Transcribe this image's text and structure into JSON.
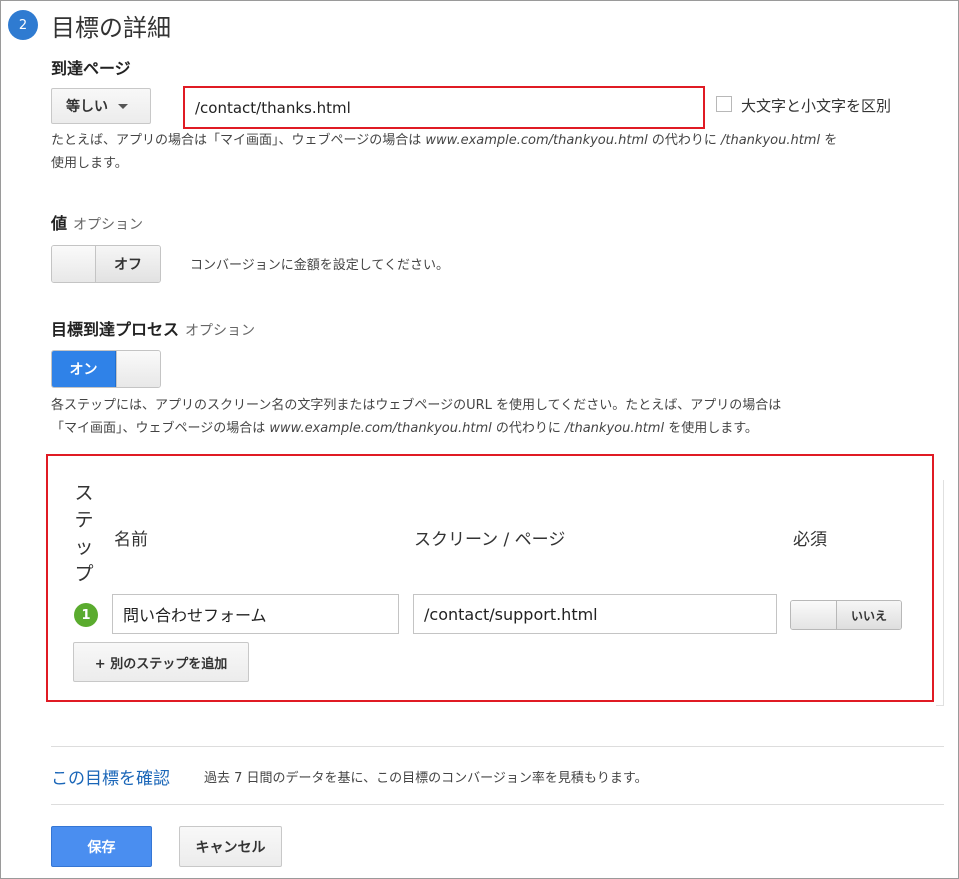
{
  "section": {
    "step_number": "2",
    "title": "目標の詳細"
  },
  "destination": {
    "label": "到達ページ",
    "match_type": "等しい",
    "url_value": "/contact/thanks.html",
    "case_sensitive_label": "大文字と小文字を区別",
    "help_part1": "たとえば、アプリの場合は「マイ画面」、ウェブページの場合は ",
    "help_example1": "www.example.com/thankyou.html",
    "help_part2": " の代わりに ",
    "help_example2": "/thankyou.html",
    "help_part3": " を",
    "help_line2": "使用します。"
  },
  "value": {
    "label": "値",
    "optional": "オプション",
    "toggle_state": "オフ",
    "description": "コンバージョンに金額を設定してください。"
  },
  "funnel": {
    "label": "目標到達プロセス",
    "optional": "オプション",
    "toggle_state": "オン",
    "help_line1": "各ステップには、アプリのスクリーン名の文字列またはウェブページのURL を使用してください。たとえば、アプリの場合は",
    "help_part1": "「マイ画面」、ウェブページの場合は ",
    "help_example1": "www.example.com/thankyou.html",
    "help_part2": " の代わりに ",
    "help_example2": "/thankyou.html",
    "help_part3": " を使用します。"
  },
  "steps": {
    "step_header": [
      "ス",
      "テ",
      "ッ",
      "プ"
    ],
    "name_header": "名前",
    "screen_header": "スクリーン / ページ",
    "required_header": "必須",
    "rows": [
      {
        "number": "1",
        "name": "問い合わせフォーム",
        "screen": "/contact/support.html",
        "required": "いいえ"
      }
    ],
    "add_button": "+ 別のステップを追加"
  },
  "verify": {
    "link": "この目標を確認",
    "text": "過去 7 日間のデータを基に、この目標のコンバージョン率を見積もります。"
  },
  "actions": {
    "save": "保存",
    "cancel": "キャンセル"
  },
  "colors": {
    "accent_blue": "#2f82e8",
    "highlight_red": "#e01b24",
    "step_green": "#5aab2e",
    "link_blue": "#1a66b8"
  }
}
